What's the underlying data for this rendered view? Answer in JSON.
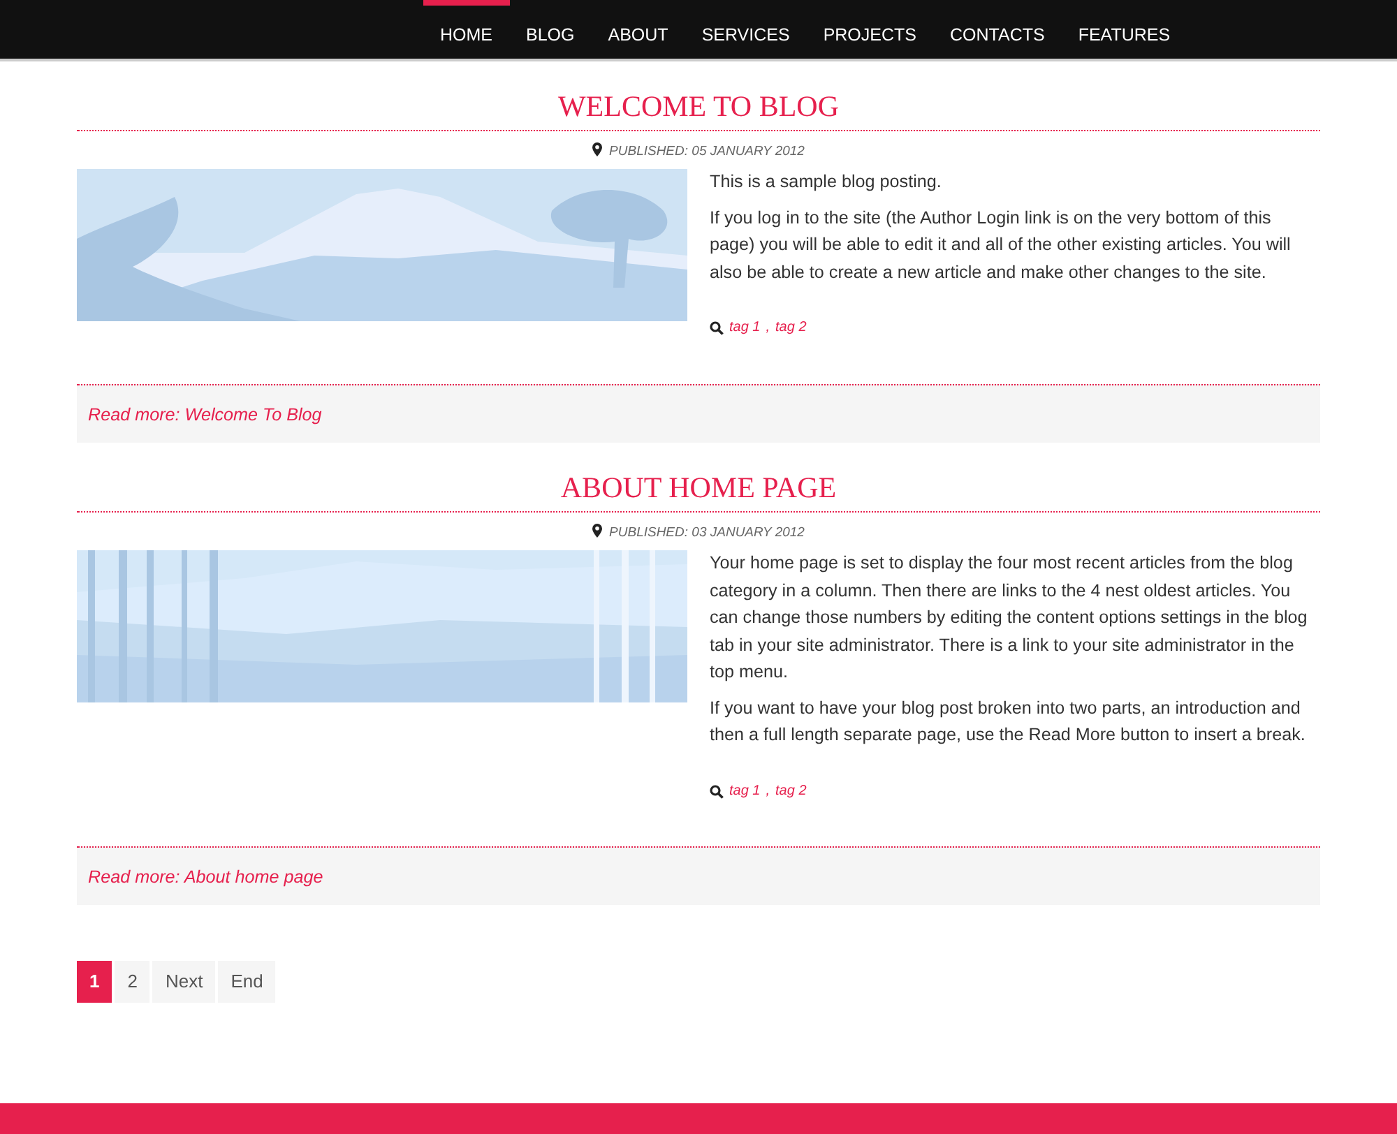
{
  "nav": [
    {
      "label": "HOME",
      "selected": true
    },
    {
      "label": "BLOG",
      "selected": false
    },
    {
      "label": "ABOUT",
      "selected": false
    },
    {
      "label": "SERVICES",
      "selected": false
    },
    {
      "label": "PROJECTS",
      "selected": false
    },
    {
      "label": "CONTACTS",
      "selected": false
    },
    {
      "label": "FEATURES",
      "selected": false
    }
  ],
  "posts": [
    {
      "title": "WELCOME TO BLOG",
      "published": "PUBLISHED: 05 JANUARY 2012",
      "image": {
        "kind": "mountain"
      },
      "paragraphs": [
        "This is a sample blog posting.",
        "If you log in to the site (the Author Login link is on the very bottom of this page) you will be able to edit it and all of the other existing articles. You will also be able to create a new article and make other changes to the site."
      ],
      "tags": [
        "tag 1",
        "tag 2"
      ],
      "tag_separator": ",",
      "read_more": "Read more: Welcome To Blog"
    },
    {
      "title": "ABOUT HOME PAGE",
      "published": "PUBLISHED: 03 JANUARY 2012",
      "image": {
        "kind": "bamboo"
      },
      "paragraphs": [
        "Your home page is set to display the four most recent articles from the blog category in a column. Then there are links to the 4 nest oldest articles. You can change those numbers by editing the content options settings in the blog tab in your site administrator. There is a link to your site administrator in the top menu.",
        "If you want to have your blog post broken into two parts, an introduction and then a full length separate page, use the Read More button to insert a break."
      ],
      "tags": [
        "tag 1",
        "tag 2"
      ],
      "tag_separator": ",",
      "read_more": "Read more: About home page"
    }
  ],
  "pagination": [
    {
      "label": "1",
      "selected": true
    },
    {
      "label": "2",
      "selected": false
    },
    {
      "label": "Next",
      "selected": false
    },
    {
      "label": "End",
      "selected": false
    }
  ]
}
